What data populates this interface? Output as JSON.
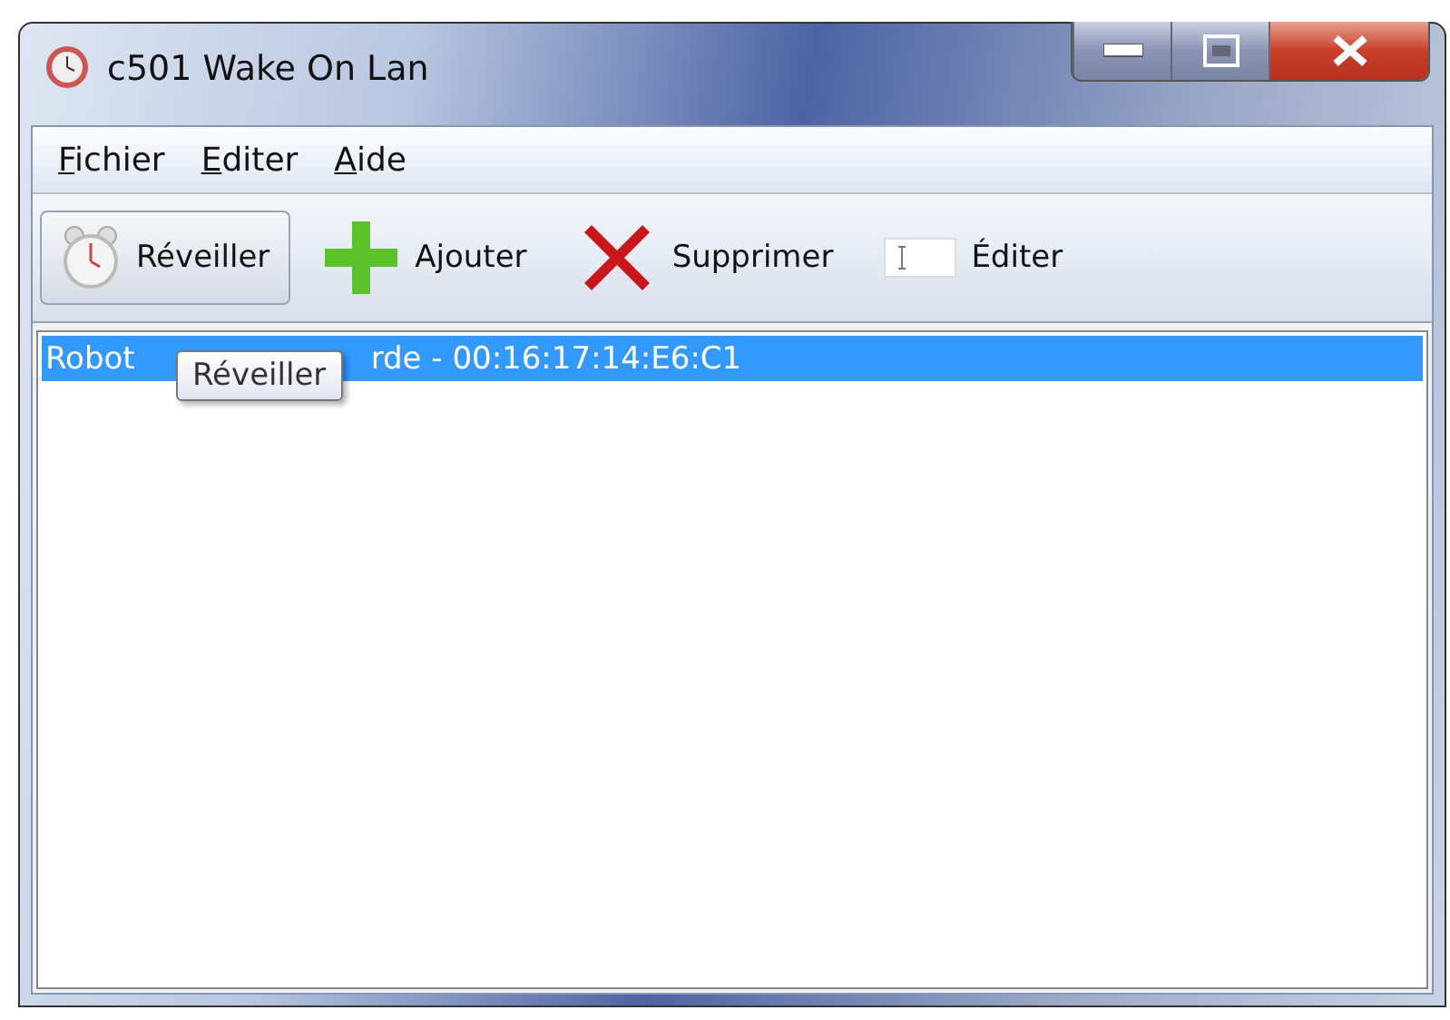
{
  "window": {
    "title": "c501 Wake On Lan"
  },
  "menu": [
    "Fichier",
    "Editer",
    "Aide"
  ],
  "toolbar": [
    {
      "kind": "clock",
      "label": "Réveiller",
      "hovered": true
    },
    {
      "kind": "add",
      "label": "Ajouter",
      "hovered": false
    },
    {
      "kind": "delete",
      "label": "Supprimer",
      "hovered": false
    },
    {
      "kind": "edit",
      "label": "Éditer",
      "hovered": false
    }
  ],
  "list": [
    {
      "text_before": "Robot",
      "text_after": "rde - 00:16:17:14:E6:C1",
      "selected": true
    }
  ],
  "tooltip": "Réveiller"
}
